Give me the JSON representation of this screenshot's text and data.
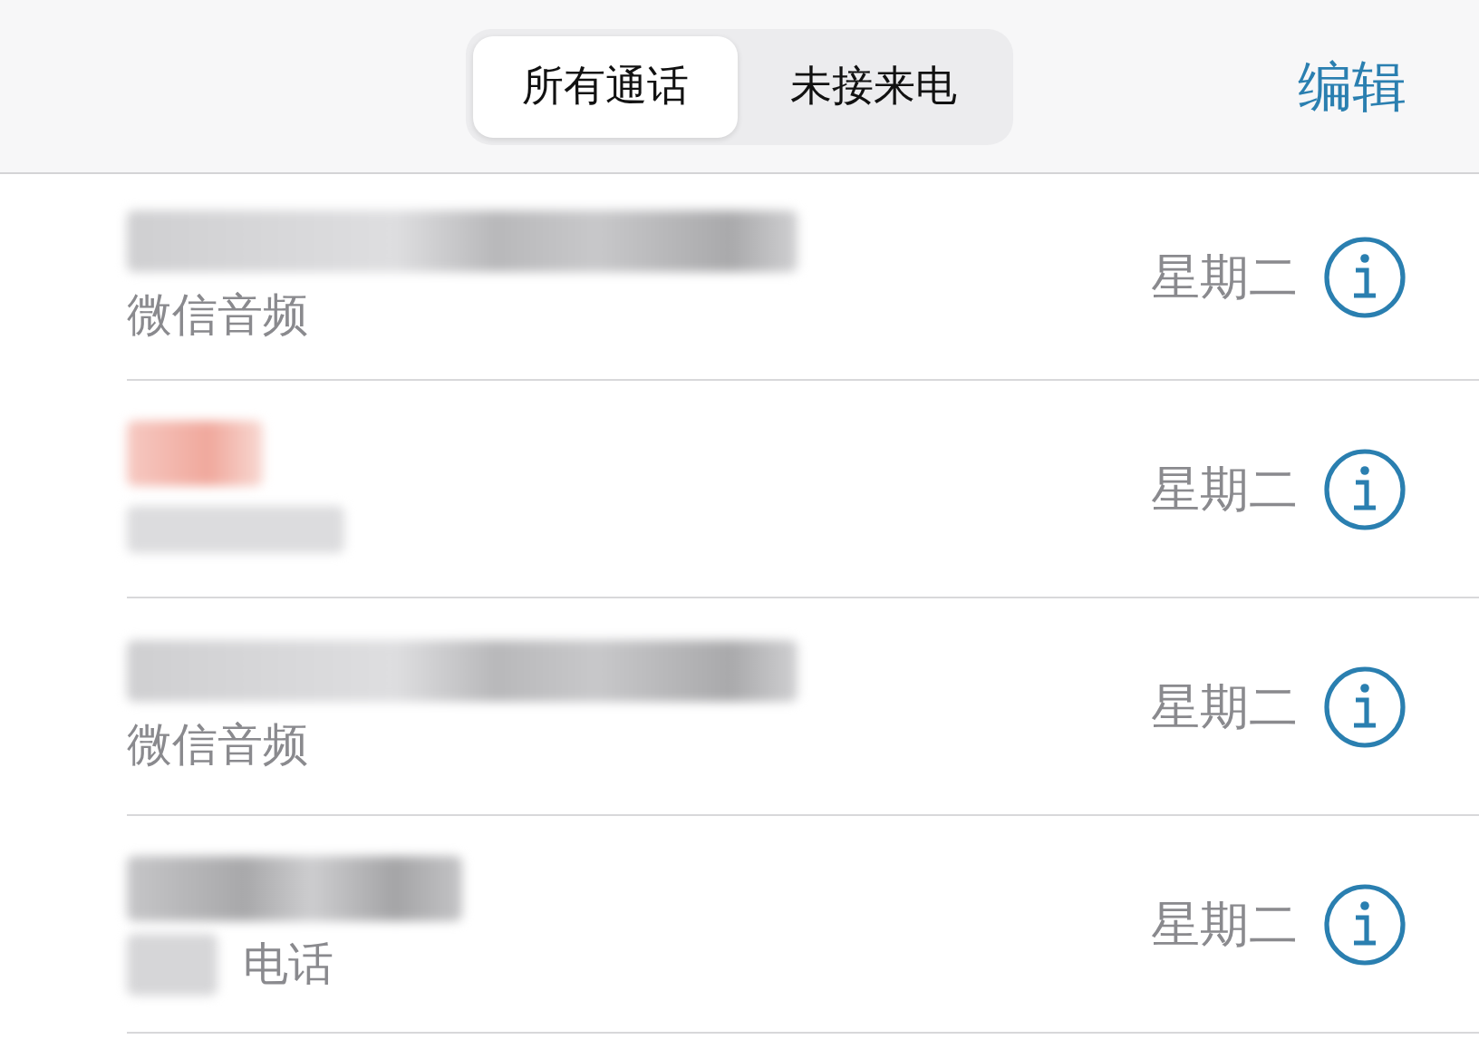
{
  "segmented_control": [
    {
      "label": "所有通话",
      "selected": true
    },
    {
      "label": "未接来电",
      "selected": false
    }
  ],
  "edit_button": "编辑",
  "calls": [
    {
      "kind": "audio",
      "subtitle": "微信音频",
      "date": "星期二"
    },
    {
      "kind": "missed",
      "date": "星期二"
    },
    {
      "kind": "audio",
      "subtitle": "微信音频",
      "date": "星期二"
    },
    {
      "kind": "phone",
      "subtitle": "电话",
      "date": "星期二"
    }
  ]
}
